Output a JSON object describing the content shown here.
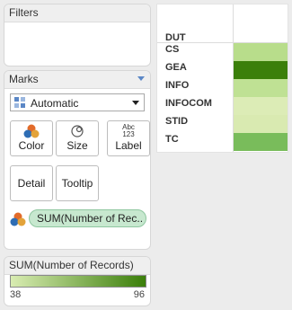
{
  "filters": {
    "title": "Filters"
  },
  "marks": {
    "title": "Marks",
    "mark_type": "Automatic",
    "buttons": {
      "color": "Color",
      "size": "Size",
      "label": "Label",
      "label_glyph_top": "Abc",
      "label_glyph_bottom": "123",
      "detail": "Detail",
      "tooltip": "Tooltip"
    },
    "color_field": "SUM(Number of Rec.."
  },
  "legend": {
    "title": "SUM(Number of Records)",
    "min": "38",
    "max": "96",
    "color_low": "#d9ecb2",
    "color_high": "#3b7f0a"
  },
  "viz": {
    "dimension_header": "DUT",
    "rows": [
      {
        "label": "CS",
        "value": 58,
        "color": "#b8dd8b"
      },
      {
        "label": "GEA",
        "value": 96,
        "color": "#3b7f0a"
      },
      {
        "label": "INFO",
        "value": 55,
        "color": "#bfe194"
      },
      {
        "label": "INFOCOM",
        "value": 38,
        "color": "#dcecb6"
      },
      {
        "label": "STID",
        "value": 40,
        "color": "#d9eab1"
      },
      {
        "label": "TC",
        "value": 70,
        "color": "#79bc5b"
      }
    ]
  }
}
